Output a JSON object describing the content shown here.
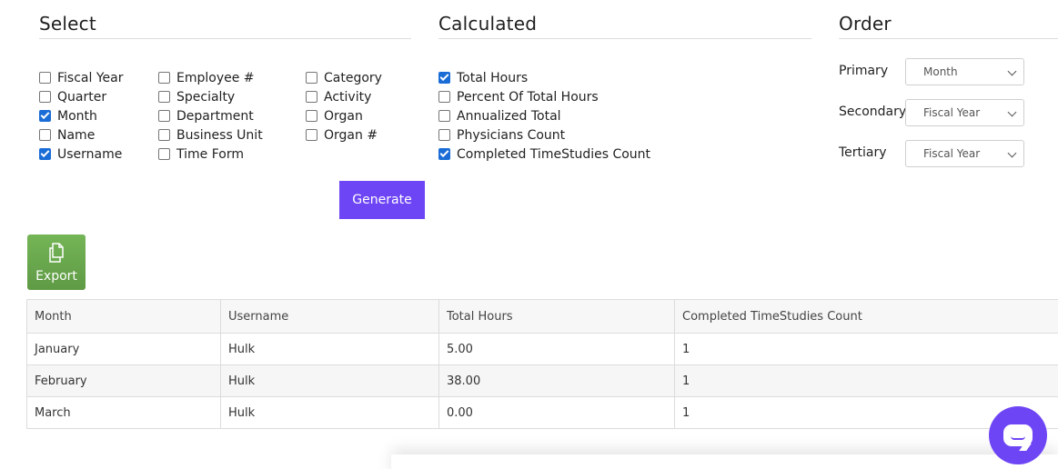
{
  "select": {
    "title": "Select",
    "columns": [
      [
        {
          "label": "Fiscal Year",
          "checked": false
        },
        {
          "label": "Quarter",
          "checked": false
        },
        {
          "label": "Month",
          "checked": true
        },
        {
          "label": "Name",
          "checked": false
        },
        {
          "label": "Username",
          "checked": true
        }
      ],
      [
        {
          "label": "Employee #",
          "checked": false
        },
        {
          "label": "Specialty",
          "checked": false
        },
        {
          "label": "Department",
          "checked": false
        },
        {
          "label": "Business Unit",
          "checked": false
        },
        {
          "label": "Time Form",
          "checked": false
        }
      ],
      [
        {
          "label": "Category",
          "checked": false
        },
        {
          "label": "Activity",
          "checked": false
        },
        {
          "label": "Organ",
          "checked": false
        },
        {
          "label": "Organ #",
          "checked": false
        }
      ]
    ],
    "generate_label": "Generate"
  },
  "calculated": {
    "title": "Calculated",
    "items": [
      {
        "label": "Total Hours",
        "checked": true
      },
      {
        "label": "Percent Of Total Hours",
        "checked": false
      },
      {
        "label": "Annualized Total",
        "checked": false
      },
      {
        "label": "Physicians Count",
        "checked": false
      },
      {
        "label": "Completed TimeStudies Count",
        "checked": true
      }
    ]
  },
  "order": {
    "title": "Order",
    "fields": [
      {
        "label": "Primary",
        "value": "Month"
      },
      {
        "label": "Secondary",
        "value": "Fiscal Year"
      },
      {
        "label": "Tertiary",
        "value": "Fiscal Year"
      }
    ]
  },
  "export": {
    "label": "Export",
    "icon": "copy-icon"
  },
  "table": {
    "headers": [
      "Month",
      "Username",
      "Total Hours",
      "Completed TimeStudies Count"
    ],
    "rows": [
      [
        "January",
        "Hulk",
        "5.00",
        "1"
      ],
      [
        "February",
        "Hulk",
        "38.00",
        "1"
      ],
      [
        "March",
        "Hulk",
        "0.00",
        "1"
      ]
    ]
  },
  "chat": {
    "icon": "chat-icon",
    "color": "#6e45f5"
  },
  "colors": {
    "accent": "#6e45f5",
    "export_green": "#6aa84f",
    "checkbox_blue": "#1a6cd6"
  }
}
